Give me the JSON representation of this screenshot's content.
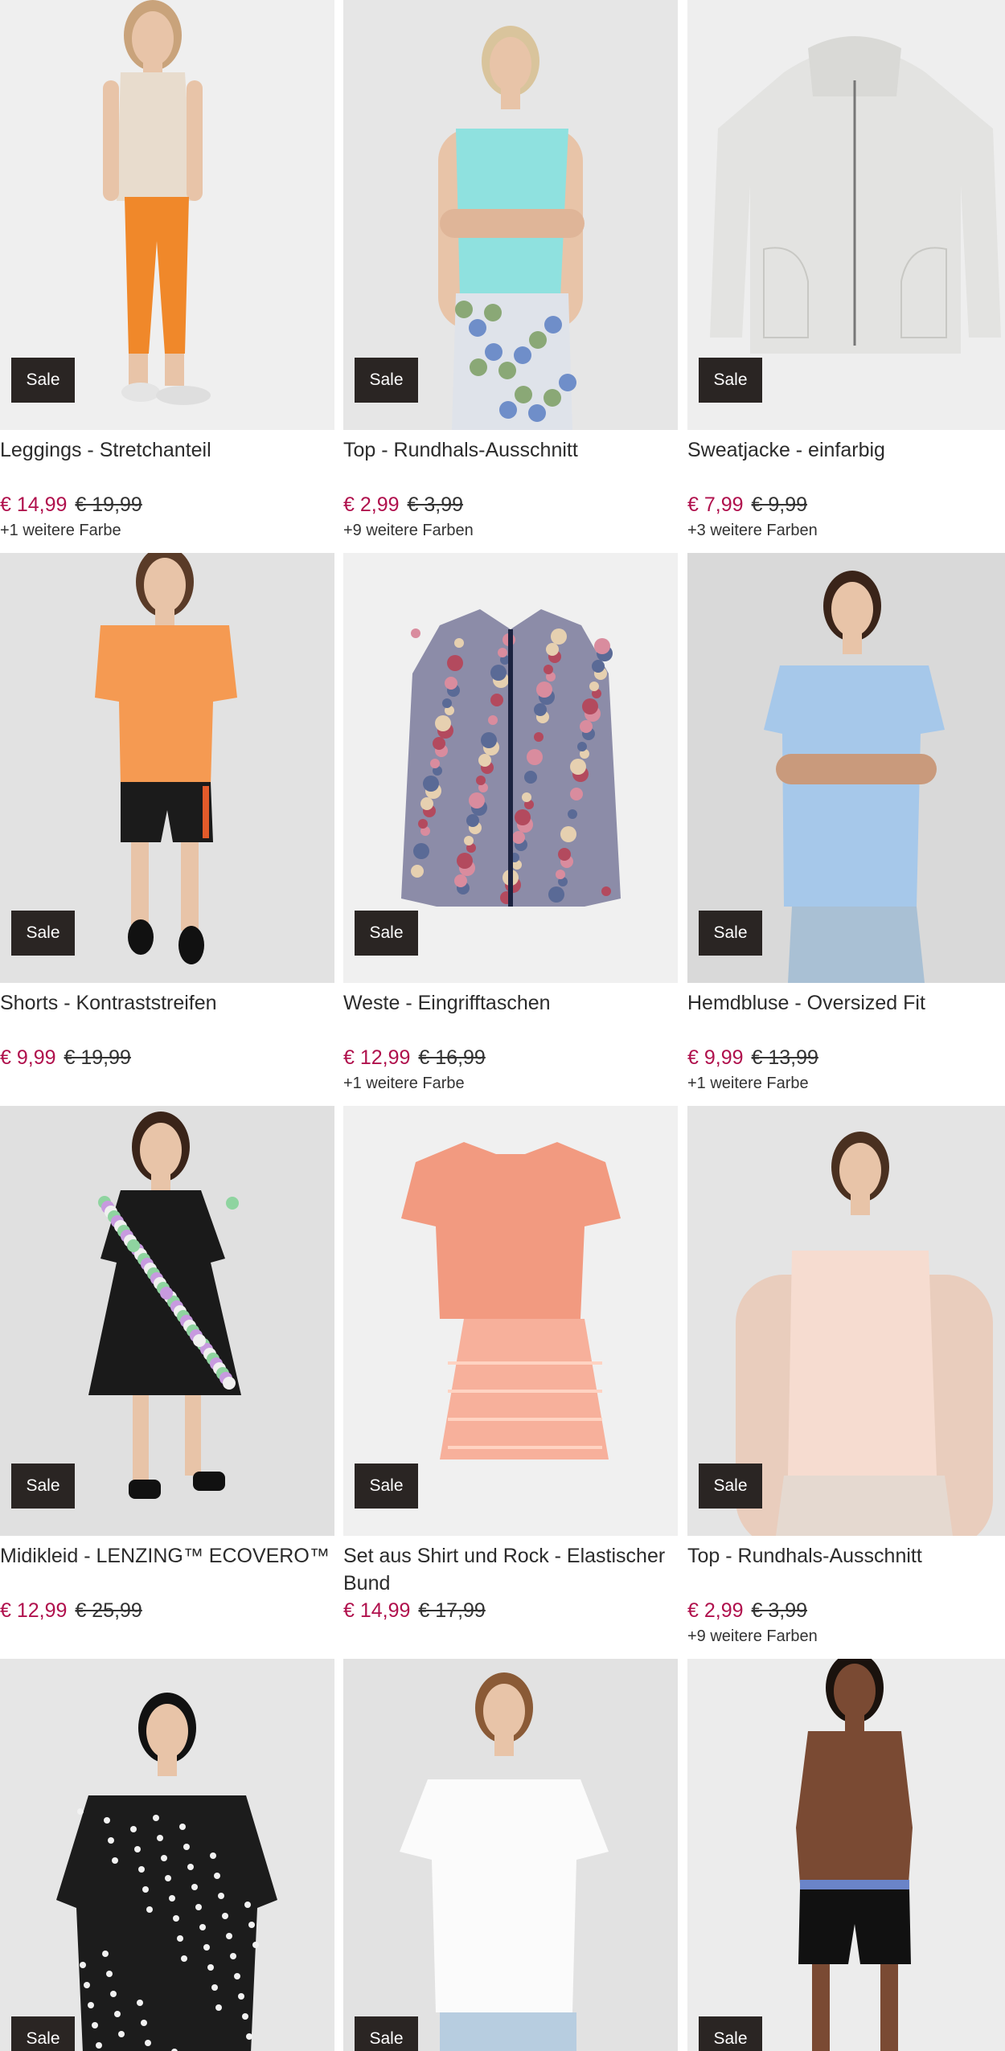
{
  "sale_label": "Sale",
  "products": [
    {
      "title": "Leggings - Stretchanteil",
      "price": "€ 14,99",
      "old_price": "€ 19,99",
      "more": "+1 weitere Farbe",
      "bg": "#efefef",
      "art": "leggings"
    },
    {
      "title": "Top - Rundhals-Ausschnitt",
      "price": "€ 2,99",
      "old_price": "€ 3,99",
      "more": "+9 weitere Farben",
      "bg": "#e6e6e6",
      "art": "turquoise-top"
    },
    {
      "title": "Sweatjacke - einfarbig",
      "price": "€ 7,99",
      "old_price": "€ 9,99",
      "more": "+3 weitere Farben",
      "bg": "#eeeeee",
      "art": "sweatjacket"
    },
    {
      "title": "Shorts - Kontraststreifen",
      "price": "€ 9,99",
      "old_price": "€ 19,99",
      "more": "",
      "bg": "#e2e2e2",
      "art": "shorts"
    },
    {
      "title": "Weste - Eingrifftaschen",
      "price": "€ 12,99",
      "old_price": "€ 16,99",
      "more": "+1 weitere Farbe",
      "bg": "#f0f0f0",
      "art": "vest"
    },
    {
      "title": "Hemdbluse - Oversized Fit",
      "price": "€ 9,99",
      "old_price": "€ 13,99",
      "more": "+1 weitere Farbe",
      "bg": "#d9d9d9",
      "art": "blouse"
    },
    {
      "title": "Midikleid - LENZING™ ECOVERO™",
      "price": "€ 12,99",
      "old_price": "€ 25,99",
      "more": "",
      "bg": "#e0e0e0",
      "art": "dress"
    },
    {
      "title": "Set aus Shirt und Rock - Elastischer Bund",
      "price": "€ 14,99",
      "old_price": "€ 17,99",
      "more": "",
      "bg": "#f0f0f0",
      "art": "set"
    },
    {
      "title": "Top - Rundhals-Ausschnitt",
      "price": "€ 2,99",
      "old_price": "€ 3,99",
      "more": "+9 weitere Farben",
      "bg": "#e4e4e4",
      "art": "pink-top"
    },
    {
      "title": "",
      "price": "",
      "old_price": "",
      "more": "",
      "bg": "#e6e6e6",
      "art": "blouse-dots"
    },
    {
      "title": "",
      "price": "",
      "old_price": "",
      "more": "",
      "bg": "#e2e2e2",
      "art": "tshirt-white"
    },
    {
      "title": "",
      "price": "",
      "old_price": "",
      "more": "",
      "bg": "#ececec",
      "art": "men-shorts"
    }
  ]
}
